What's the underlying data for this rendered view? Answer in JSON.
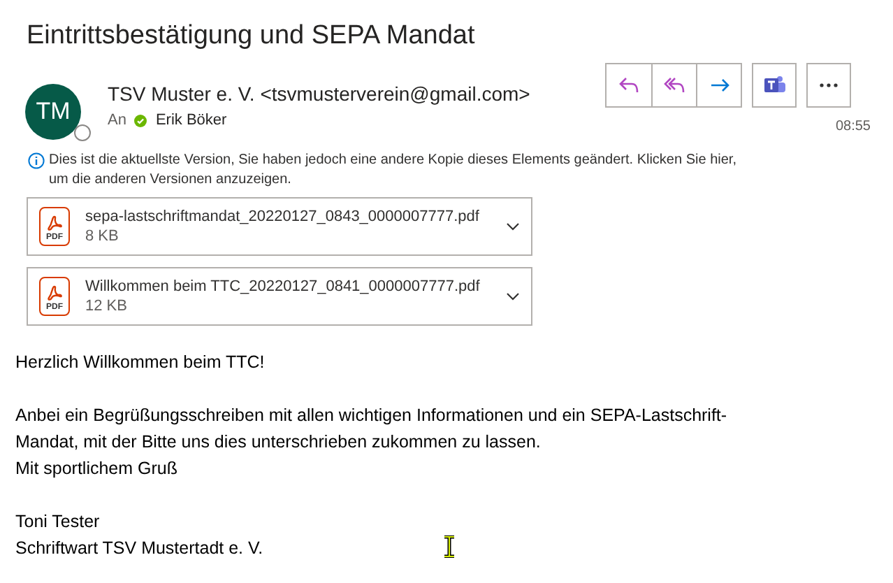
{
  "subject": "Eintrittsbestätigung und SEPA Mandat",
  "sender": {
    "initials": "TM",
    "name": "TSV Muster e. V. <tsvmusterverein@gmail.com>",
    "to_label": "An",
    "recipient": "Erik Böker",
    "time": "08:55"
  },
  "info": [
    "Dies ist die aktuellste Version, Sie haben jedoch eine andere Kopie dieses Elements geändert. Klicken Sie hier,",
    "um die anderen Versionen anzuzeigen."
  ],
  "attachments": [
    {
      "name": "sepa-lastschriftmandat_20220127_0843_0000007777.pdf",
      "size": "8 KB",
      "icon_label": "PDF"
    },
    {
      "name": "Willkommen beim TTC_20220127_0841_0000007777.pdf",
      "size": "12 KB",
      "icon_label": "PDF"
    }
  ],
  "body": [
    [
      "Herzlich Willkommen beim TTC!"
    ],
    [
      "Anbei ein Begrüßungsschreiben mit allen wichtigen Informationen und ein SEPA-Lastschrift-",
      "Mandat, mit der Bitte uns dies unterschrieben zukommen zu lassen.",
      "Mit sportlichem Gruß"
    ],
    [
      "Toni Tester",
      "Schriftwart TSV Mustertadt e. V."
    ]
  ]
}
